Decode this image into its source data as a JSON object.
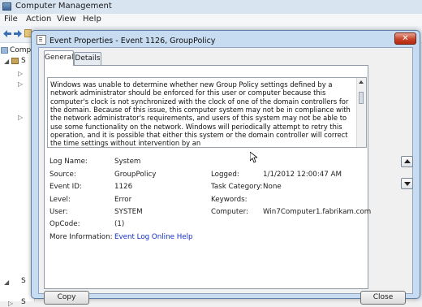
{
  "app": {
    "title": "Computer Management",
    "menu": [
      "File",
      "Action",
      "View",
      "Help"
    ],
    "tree_labels": [
      "Compu",
      "S",
      "S",
      "S"
    ]
  },
  "dialog": {
    "title": "Event Properties - Event 1126, GroupPolicy",
    "close_glyph": "✕",
    "tabs": [
      {
        "label": "General",
        "active": true
      },
      {
        "label": "Details",
        "active": false
      }
    ],
    "description": "Windows was unable to determine whether new Group Policy settings defined by a network administrator should be enforced for this user or computer because this computer's clock is not synchronized with the clock of one of the domain controllers for the domain. Because of this issue, this computer system may not be in compliance with the network administrator's requirements, and users of this system may not be able to use some functionality on the network. Windows will periodically attempt to retry this operation, and it is possible that either this system or the domain controller will correct the time settings without intervention by an",
    "fields": {
      "log_name_label": "Log Name:",
      "log_name": "System",
      "source_label": "Source:",
      "source": "GroupPolicy",
      "logged_label": "Logged:",
      "logged": "1/1/2012 12:00:47 AM",
      "event_id_label": "Event ID:",
      "event_id": "1126",
      "task_category_label": "Task Category:",
      "task_category": "None",
      "level_label": "Level:",
      "level": "Error",
      "keywords_label": "Keywords:",
      "user_label": "User:",
      "user": "SYSTEM",
      "computer_label": "Computer:",
      "computer": "Win7Computer1.fabrikam.com",
      "opcode_label": "OpCode:",
      "opcode": "(1)",
      "more_info_label": "More Information:",
      "more_info_link": "Event Log Online Help"
    },
    "buttons": {
      "copy": "Copy",
      "close": "Close"
    }
  }
}
